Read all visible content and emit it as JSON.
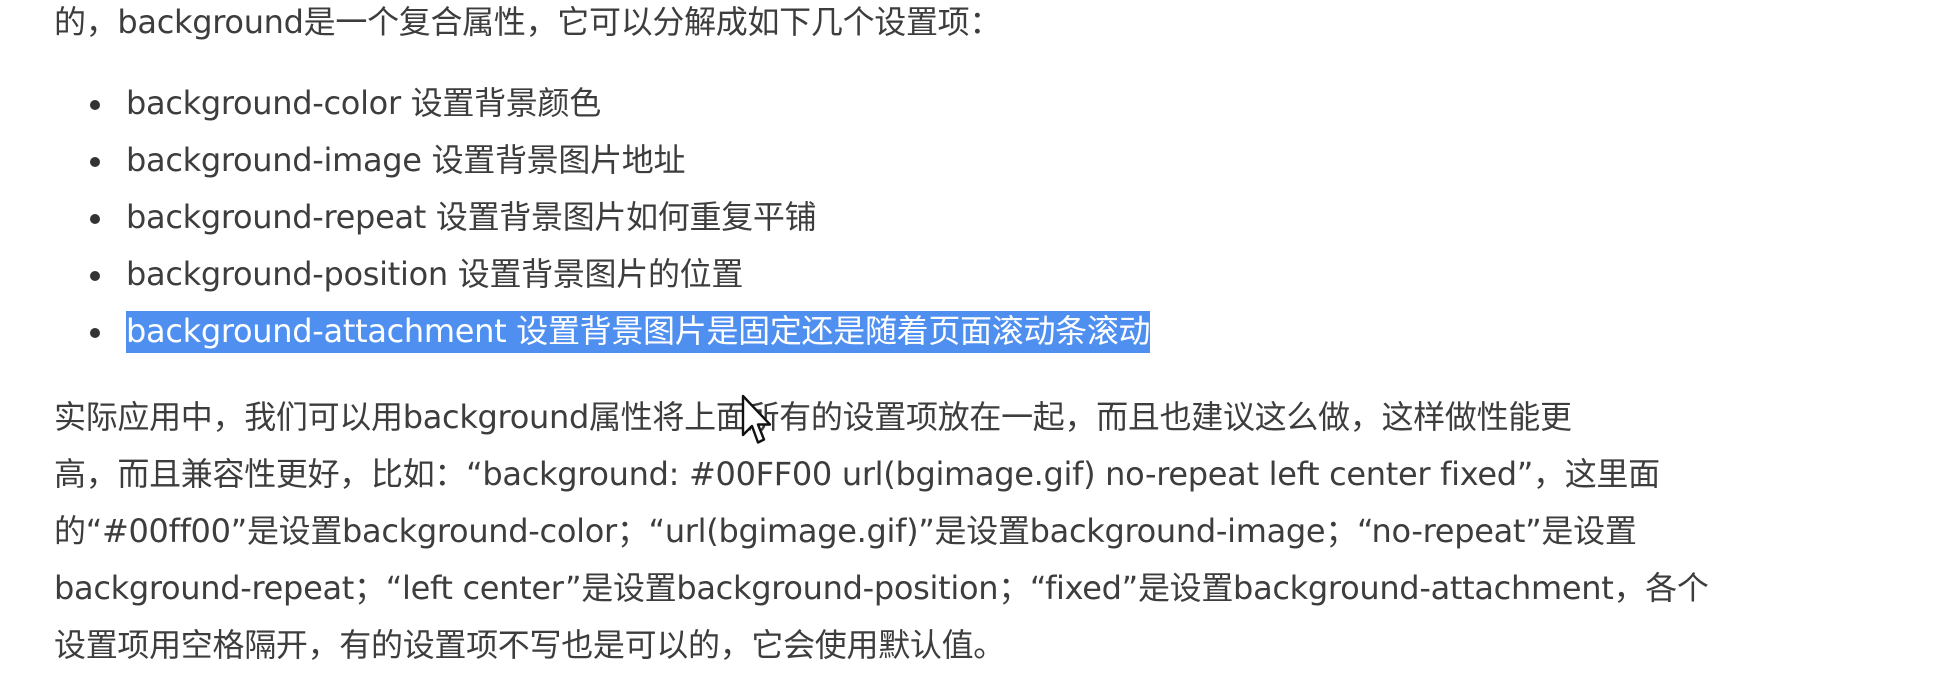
{
  "intro_text": "的，background是一个复合属性，它可以分解成如下几个设置项：",
  "properties": [
    {
      "name": "background-color",
      "desc": "设置背景颜色"
    },
    {
      "name": "background-image",
      "desc": "设置背景图片地址"
    },
    {
      "name": "background-repeat",
      "desc": "设置背景图片如何重复平铺"
    },
    {
      "name": "background-position",
      "desc": "设置背景图片的位置"
    },
    {
      "name": "background-attachment",
      "desc": "设置背景图片是固定还是随着页面滚动条滚动"
    }
  ],
  "selected_item": "background-attachment 设置背景图片是固定还是随着页面滚动条滚动",
  "paragraph_lines": [
    "实际应用中，我们可以用background属性将上面所有的设置项放在一起，而且也建议这么做，这样做性能更",
    "高，而且兼容性更好，比如：“background: #00FF00 url(bgimage.gif) no-repeat left center fixed”，这里面",
    "的“#00ff00”是设置background-color；“url(bgimage.gif)”是设置background-image；“no-repeat”是设置",
    "background-repeat；“left center”是设置background-position；“fixed”是设置background-attachment，各个",
    "设置项用空格隔开，有的设置项不写也是可以的，它会使用默认值。"
  ],
  "selection_color": "#4e8ff0",
  "text_color": "#3d3d3d"
}
